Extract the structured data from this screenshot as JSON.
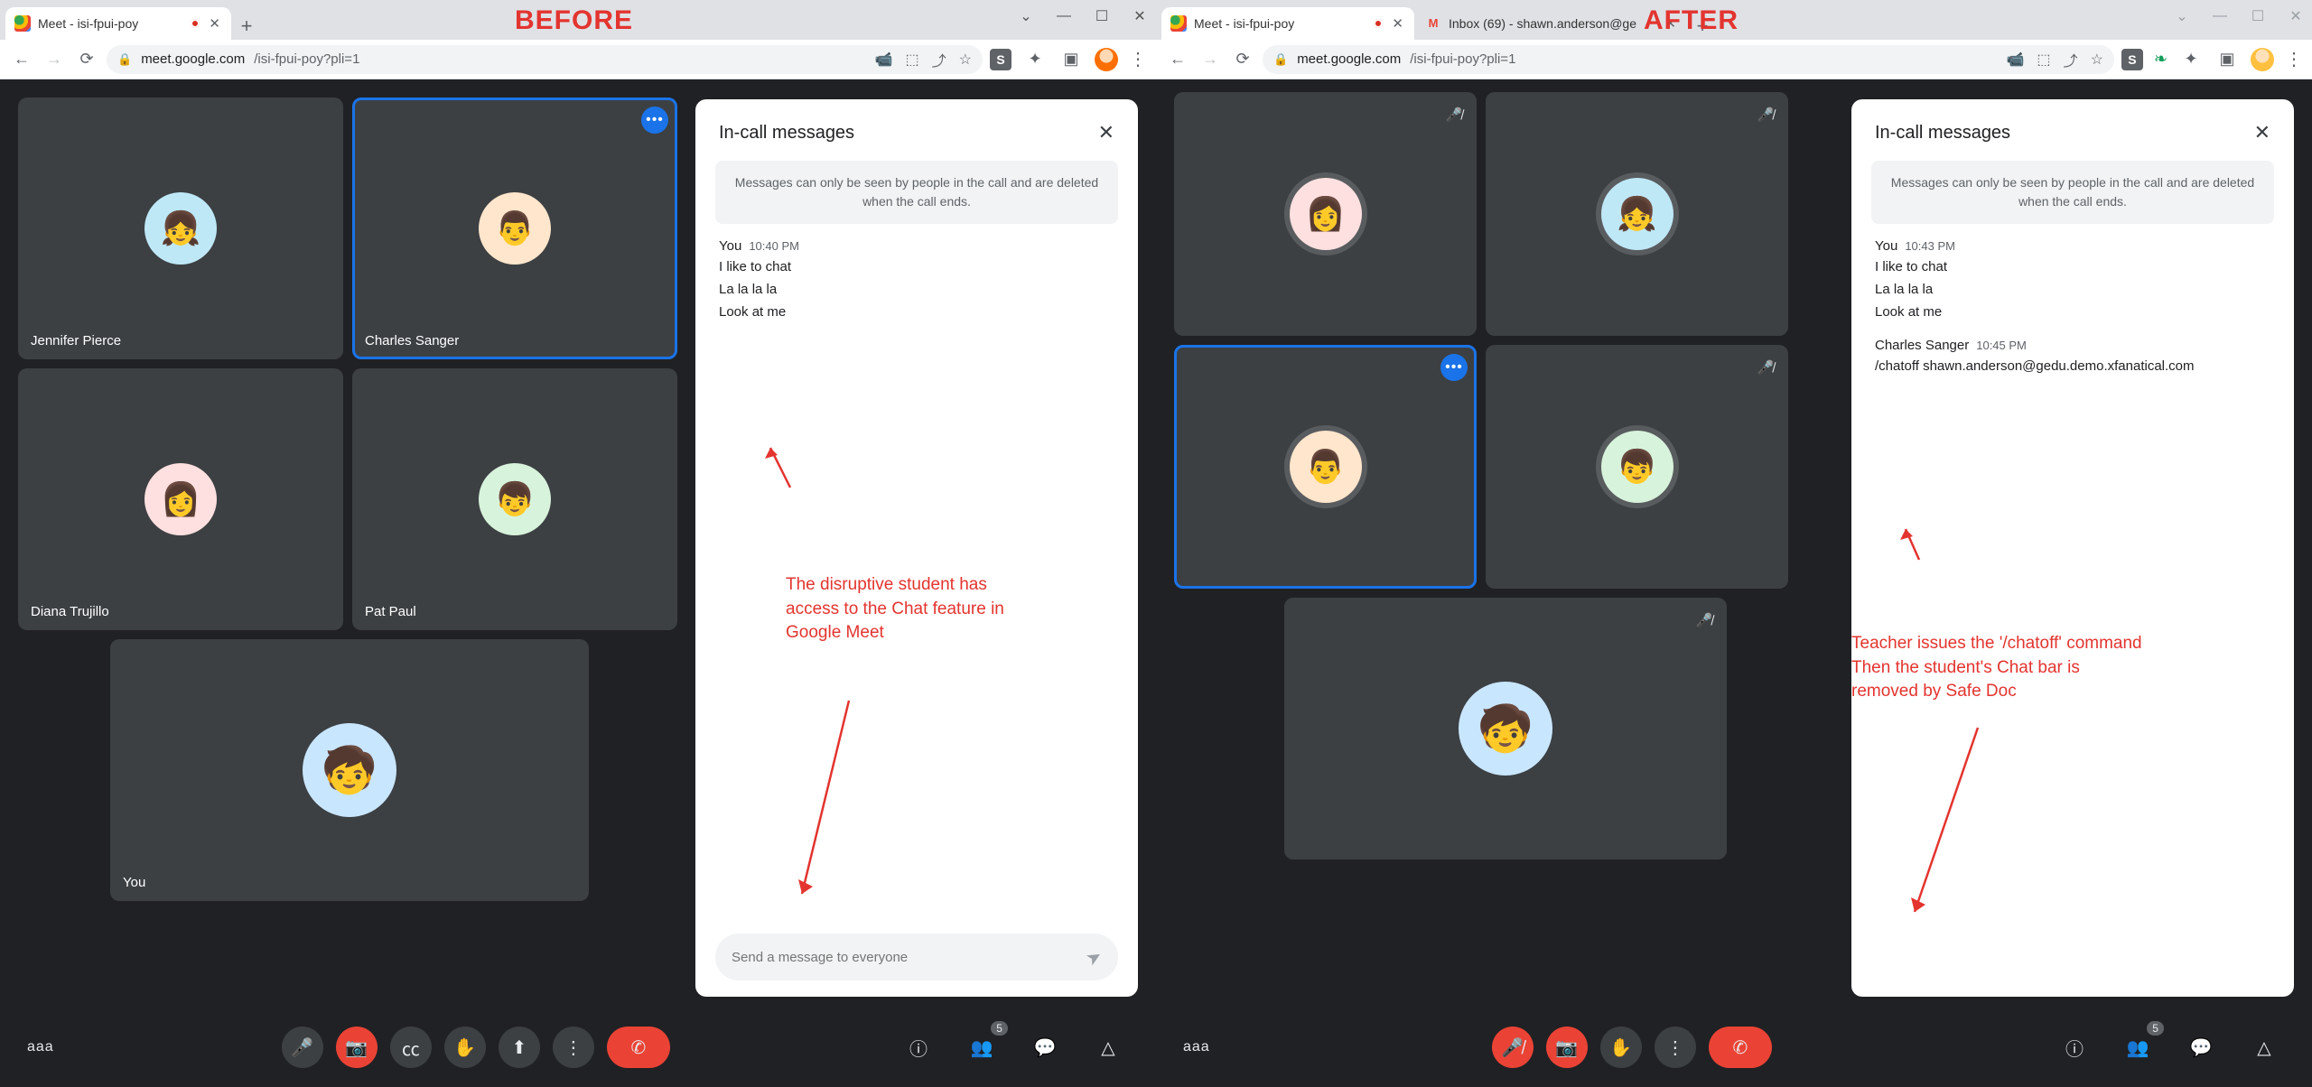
{
  "labels": {
    "before": "BEFORE",
    "after": "AFTER"
  },
  "chrome": {
    "tab_meet_title": "Meet - isi-fpui-poy",
    "tab_gmail_title": "Inbox (69) - shawn.anderson@ge",
    "url_host": "meet.google.com",
    "url_path": "/isi-fpui-poy?pli=1"
  },
  "chat": {
    "title": "In-call messages",
    "info": "Messages can only be seen by people in the call and are deleted when the call ends.",
    "input_placeholder": "Send a message to everyone"
  },
  "before": {
    "participants": {
      "p1": "Jennifer Pierce",
      "p2": "Charles Sanger",
      "p3": "Diana Trujillo",
      "p4": "Pat Paul",
      "p5": "You"
    },
    "room_code": "aaa",
    "people_badge": "5",
    "messages": {
      "m1": {
        "who": "You",
        "time": "10:40 PM",
        "l1": "I like to chat",
        "l2": "La la la la",
        "l3": "Look at me"
      }
    },
    "annotation": "The disruptive student has\naccess to the Chat feature in\nGoogle Meet"
  },
  "after": {
    "room_code": "aaa",
    "people_badge": "5",
    "messages": {
      "m1": {
        "who": "You",
        "time": "10:43 PM",
        "l1": "I like to chat",
        "l2": "La la la la",
        "l3": "Look at me"
      },
      "m2": {
        "who": "Charles Sanger",
        "time": "10:45 PM",
        "l1": "/chatoff shawn.anderson@gedu.demo.xfanatical.com"
      }
    },
    "annotation": "Teacher issues the '/chatoff' command\nThen the student's Chat bar is\nremoved by Safe Doc"
  }
}
